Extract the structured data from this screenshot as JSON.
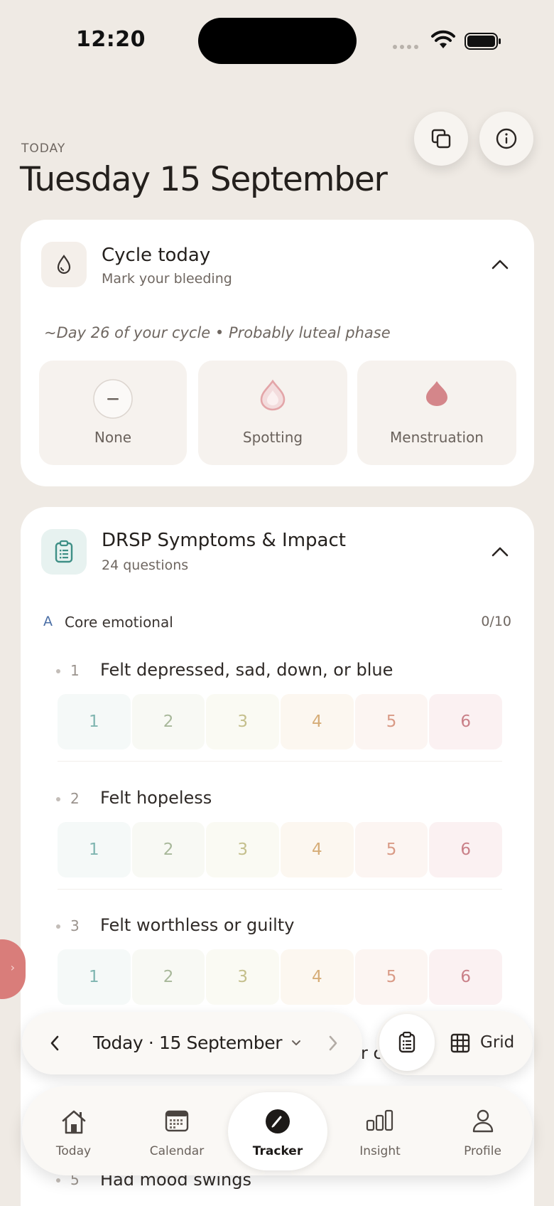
{
  "status_bar": {
    "time": "12:20"
  },
  "header": {
    "overline": "TODAY",
    "title": "Tuesday 15 September"
  },
  "cycle_card": {
    "title": "Cycle today",
    "subtitle": "Mark your bleeding",
    "note": "~Day 26 of your cycle • Probably luteal phase",
    "options": [
      {
        "label": "None",
        "icon": "dash-circle-icon"
      },
      {
        "label": "Spotting",
        "icon": "drop-outline-icon"
      },
      {
        "label": "Menstruation",
        "icon": "drop-filled-icon"
      }
    ]
  },
  "drsp_card": {
    "title": "DRSP Symptoms & Impact",
    "subtitle": "24 questions",
    "section": {
      "letter": "A",
      "label": "Core emotional",
      "count": "0/10"
    },
    "scale": [
      "1",
      "2",
      "3",
      "4",
      "5",
      "6"
    ],
    "questions": [
      {
        "num": "1",
        "text": "Felt depressed, sad, down, or blue"
      },
      {
        "num": "2",
        "text": "Felt hopeless"
      },
      {
        "num": "3",
        "text": "Felt worthless or guilty"
      }
    ],
    "partial_question": {
      "num": "5",
      "text": "Had mood swings"
    },
    "partial_peek": "r c"
  },
  "date_bar": {
    "label": "Today · 15 September"
  },
  "view_toggle": {
    "grid_label": "Grid"
  },
  "tabs": [
    {
      "label": "Today",
      "icon": "house-icon"
    },
    {
      "label": "Calendar",
      "icon": "calendar-icon"
    },
    {
      "label": "Tracker",
      "icon": "tracker-pen-icon"
    },
    {
      "label": "Insight",
      "icon": "bar-chart-icon"
    },
    {
      "label": "Profile",
      "icon": "person-icon"
    }
  ],
  "colors": {
    "background": "#efeae4",
    "accent_teal": "#3e8f86",
    "menstruation": "#d4868a",
    "scale_1": "#7fb5b0",
    "scale_2": "#a8b89a",
    "scale_3": "#c4bf8c",
    "scale_4": "#d6ad78",
    "scale_5": "#d99a86",
    "scale_6": "#c98088"
  }
}
